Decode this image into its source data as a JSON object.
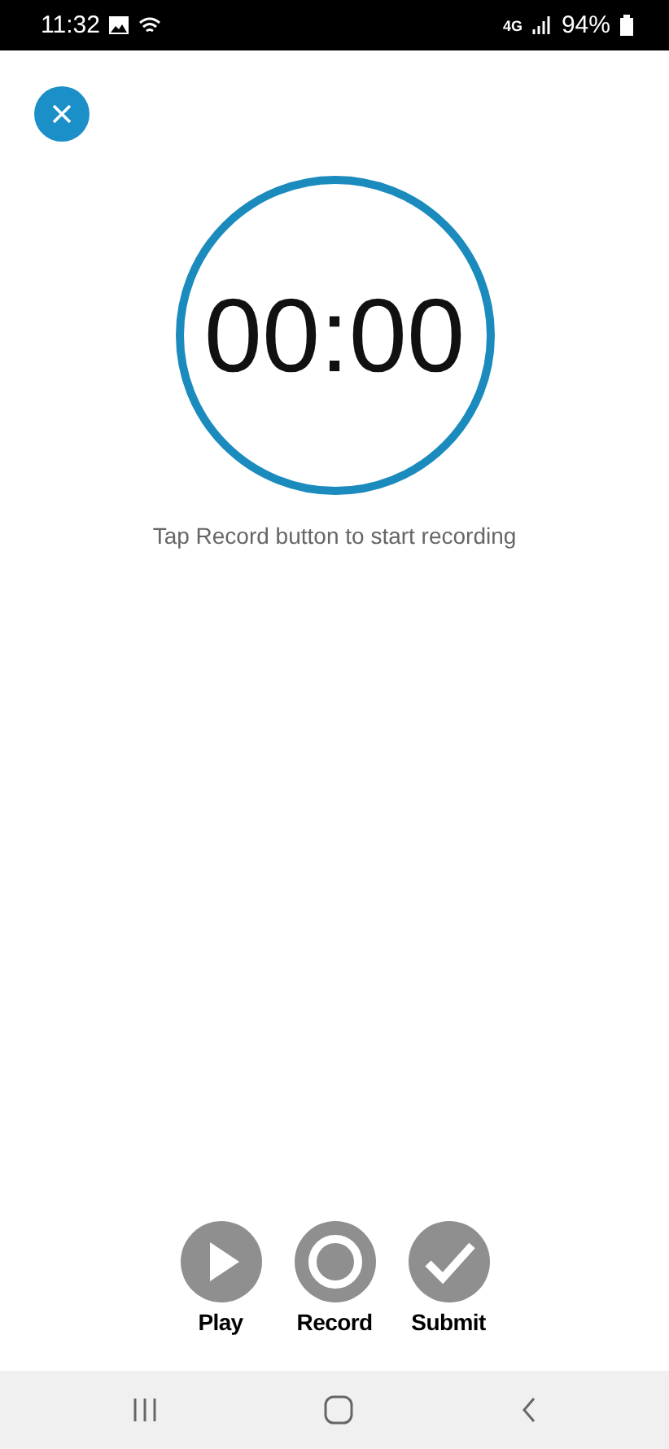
{
  "status_bar": {
    "time": "11:32",
    "network": "4G",
    "battery": "94%"
  },
  "timer": {
    "reading": "00:00",
    "hint": "Tap Record button to start recording"
  },
  "controls": [
    {
      "kind": "play",
      "label": "Play"
    },
    {
      "kind": "record",
      "label": "Record"
    },
    {
      "kind": "submit",
      "label": "Submit"
    }
  ]
}
